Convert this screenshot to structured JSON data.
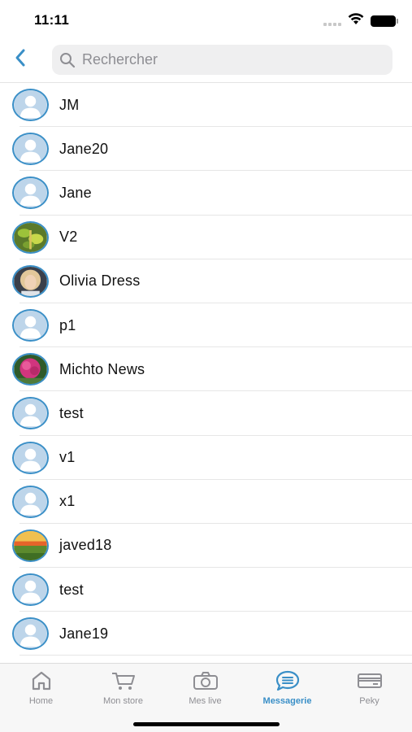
{
  "status_bar": {
    "time": "11:11",
    "icons": [
      "signal-icon",
      "wifi-icon",
      "battery-icon"
    ]
  },
  "header": {
    "back_icon": "chevron-left-icon",
    "search": {
      "placeholder": "Rechercher",
      "value": "",
      "icon": "search-icon"
    }
  },
  "contacts": [
    {
      "name": "JM",
      "avatar": "default"
    },
    {
      "name": "Jane20",
      "avatar": "default"
    },
    {
      "name": "Jane",
      "avatar": "default"
    },
    {
      "name": "V2",
      "avatar": "photo-plant"
    },
    {
      "name": "Olivia Dress",
      "avatar": "photo-portrait"
    },
    {
      "name": "p1",
      "avatar": "default"
    },
    {
      "name": "Michto News",
      "avatar": "photo-flower"
    },
    {
      "name": "test",
      "avatar": "default"
    },
    {
      "name": "v1",
      "avatar": "default"
    },
    {
      "name": "x1",
      "avatar": "default"
    },
    {
      "name": "javed18",
      "avatar": "photo-landscape"
    },
    {
      "name": "test",
      "avatar": "default"
    },
    {
      "name": "Jane19",
      "avatar": "default"
    }
  ],
  "tab_bar": {
    "tabs": [
      {
        "label": "Home",
        "icon": "home-icon",
        "active": false
      },
      {
        "label": "Mon store",
        "icon": "cart-icon",
        "active": false
      },
      {
        "label": "Mes live",
        "icon": "camera-icon",
        "active": false
      },
      {
        "label": "Messagerie",
        "icon": "chat-icon",
        "active": true
      },
      {
        "label": "Peky",
        "icon": "card-icon",
        "active": false
      }
    ]
  },
  "colors": {
    "accent": "#3a8fc7",
    "inactive": "#8e8e93",
    "search_bg": "#efeff0",
    "divider": "#e6e6e6"
  }
}
